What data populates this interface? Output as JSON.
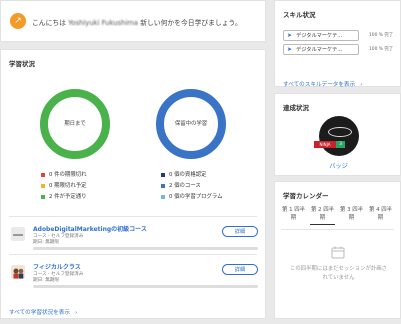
{
  "greeting": {
    "prefix": "こんにちは ",
    "name": "Yoshiyuki Fukushima",
    "suffix": " 新しい何かを今日学びましょう。"
  },
  "learning": {
    "title": "学習状況",
    "donut_left": {
      "label": "期日まで",
      "color": "#49b24a"
    },
    "donut_right": {
      "label": "保留中の学習",
      "color": "#3a74c6"
    },
    "stats_left": [
      {
        "text": "0 件の期限切れ",
        "color": "#e5403a"
      },
      {
        "text": "0 期限切れ予定",
        "color": "#f2b230"
      },
      {
        "text": "2 件が予定通り",
        "color": "#49b24a"
      }
    ],
    "stats_right": [
      {
        "text": "0 個の資格認定",
        "color": "#1d3e7a"
      },
      {
        "text": "2 個のコース",
        "color": "#3a74c6"
      },
      {
        "text": "0 個の学習プログラム",
        "color": "#6fb6e6"
      }
    ],
    "courses": [
      {
        "title": "AdobeDigitalMarketingの初級コース",
        "type": "コース - セルフ登録済み",
        "due": "期日: 無期限",
        "button": "詳細"
      },
      {
        "title": "フィジカルクラス",
        "type": "コース - セルフ登録済み",
        "due": "期日: 無期限",
        "button": "詳細"
      }
    ],
    "show_all": "すべての学習状況を表示"
  },
  "skills": {
    "title": "スキル状況",
    "items": [
      {
        "name": "デジタルマーケテ...",
        "points": "100 % 完了"
      },
      {
        "name": "デジタルマーケテ...",
        "points": "100 % 完了"
      }
    ],
    "show_all": "すべてのスキルデータを表示"
  },
  "badges": {
    "title": "達成状況",
    "ribbon_text": "NINJA",
    "count": "3",
    "link": "バッジ"
  },
  "calendar": {
    "title": "学習カレンダー",
    "quarters": [
      {
        "line1": "第 1 四半",
        "line2": "期"
      },
      {
        "line1": "第 2 四半",
        "line2": "期"
      },
      {
        "line1": "第 3 四半",
        "line2": "期"
      },
      {
        "line1": "第 4 四半",
        "line2": "期"
      }
    ],
    "active_quarter": "第 2 四半期",
    "empty_line1": "この四半期にはまだセッションが計画さ",
    "empty_line2": "れていません"
  },
  "colors": {
    "accent": "#2f6fd1",
    "greeting_icon": "#f39a28"
  }
}
